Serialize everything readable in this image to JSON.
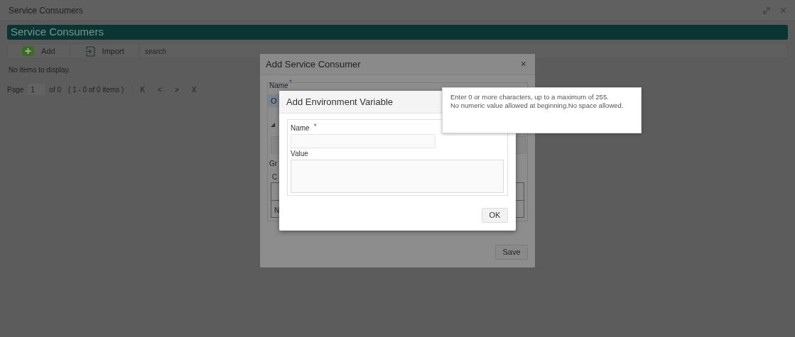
{
  "window": {
    "title": "Service Consumers"
  },
  "header": {
    "title": "Service Consumers"
  },
  "toolbar": {
    "buttons": [
      {
        "label": "Add",
        "kind": "add"
      },
      {
        "label": "Import",
        "kind": "import"
      }
    ],
    "search": {
      "placeholder": "search"
    }
  },
  "empty_message": "No items to display.",
  "pager": {
    "label": "Page",
    "page": "1",
    "of": "of 0",
    "summary": "( 1 - 0 of 0 items )",
    "nav": [
      "K",
      "<",
      ">",
      "X"
    ]
  },
  "outer_dialog": {
    "title": "Add Service Consumer",
    "close": "×",
    "name_label": "Name",
    "required_mark": "*",
    "fragments": [
      "O",
      "Gr",
      "C",
      "N"
    ],
    "save": "Save"
  },
  "inner_dialog": {
    "title": "Add Environment Variable",
    "fields": [
      {
        "label": "Name",
        "required_mark": "*",
        "kind": "input"
      },
      {
        "label": "Value",
        "kind": "textarea"
      }
    ],
    "ok": "OK"
  },
  "tooltip": {
    "lines": [
      "Enter 0 or more characters, up to a maximum of 255.",
      "No numeric value allowed at beginning.No space allowed."
    ]
  }
}
